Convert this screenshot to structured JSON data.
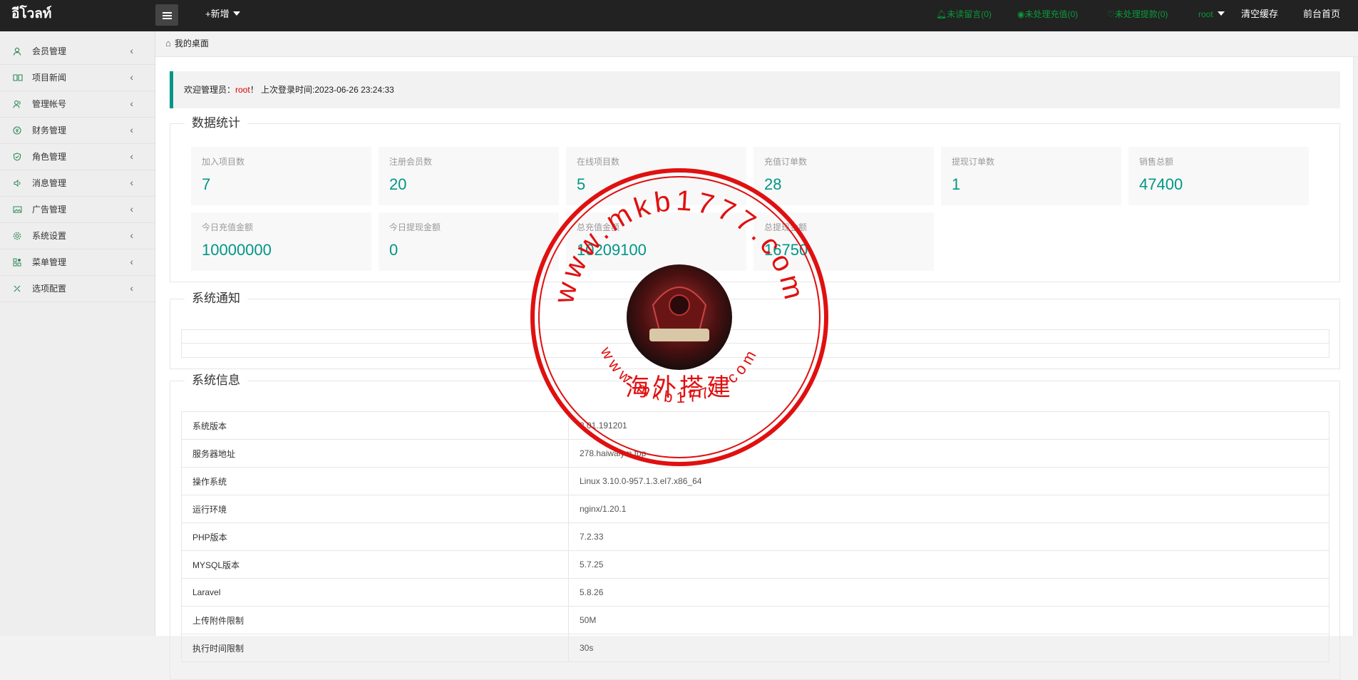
{
  "header": {
    "logo": "อีโวลท์",
    "new_label": "+新增",
    "unread_messages": "未读留言(0)",
    "pending_recharge": "未处理充值(0)",
    "pending_withdraw": "未处理提款(0)",
    "user": "root",
    "clear_cache": "清空缓存",
    "front_home": "前台首页"
  },
  "sidebar": {
    "items": [
      {
        "label": "会员管理",
        "icon": "user-icon"
      },
      {
        "label": "项目新闻",
        "icon": "book-icon"
      },
      {
        "label": "管理帐号",
        "icon": "users-icon"
      },
      {
        "label": "财务管理",
        "icon": "money-icon"
      },
      {
        "label": "角色管理",
        "icon": "shield-icon"
      },
      {
        "label": "消息管理",
        "icon": "speaker-icon"
      },
      {
        "label": "广告管理",
        "icon": "image-icon"
      },
      {
        "label": "系统设置",
        "icon": "gear-icon"
      },
      {
        "label": "菜单管理",
        "icon": "grid-icon"
      },
      {
        "label": "选项配置",
        "icon": "tools-icon"
      }
    ]
  },
  "breadcrumb": {
    "label": "我的桌面"
  },
  "welcome": {
    "prefix": "欢迎管理员：",
    "name": "root",
    "suffix": "！ 上次登录时间:2023-06-26 23:24:33"
  },
  "stats": {
    "title": "数据统计",
    "items": [
      {
        "label": "加入项目数",
        "value": "7"
      },
      {
        "label": "注册会员数",
        "value": "20"
      },
      {
        "label": "在线项目数",
        "value": "5"
      },
      {
        "label": "充值订单数",
        "value": "28"
      },
      {
        "label": "提现订单数",
        "value": "1"
      },
      {
        "label": "销售总额",
        "value": "47400"
      },
      {
        "label": "今日充值金额",
        "value": "10000000"
      },
      {
        "label": "今日提现金额",
        "value": "0"
      },
      {
        "label": "总充值金额",
        "value": "10209100"
      },
      {
        "label": "总提现金额",
        "value": "16750"
      }
    ]
  },
  "notice": {
    "title": "系统通知"
  },
  "sysinfo": {
    "title": "系统信息",
    "rows": [
      {
        "key": "系统版本",
        "value": "2.01.191201"
      },
      {
        "key": "服务器地址",
        "value": "278.haiwaiym.top"
      },
      {
        "key": "操作系统",
        "value": "Linux 3.10.0-957.1.3.el7.x86_64"
      },
      {
        "key": "运行环境",
        "value": "nginx/1.20.1"
      },
      {
        "key": "PHP版本",
        "value": "7.2.33"
      },
      {
        "key": "MYSQL版本",
        "value": "5.7.25"
      },
      {
        "key": "Laravel",
        "value": "5.8.26"
      },
      {
        "key": "上传附件限制",
        "value": "50M"
      },
      {
        "key": "执行时间限制",
        "value": "30s"
      }
    ]
  },
  "stamp": {
    "top_text": "www.mkb1777.com",
    "bottom_text": "www.mkb1777.com",
    "center_text": "海外搭建",
    "color": "#e01010"
  }
}
